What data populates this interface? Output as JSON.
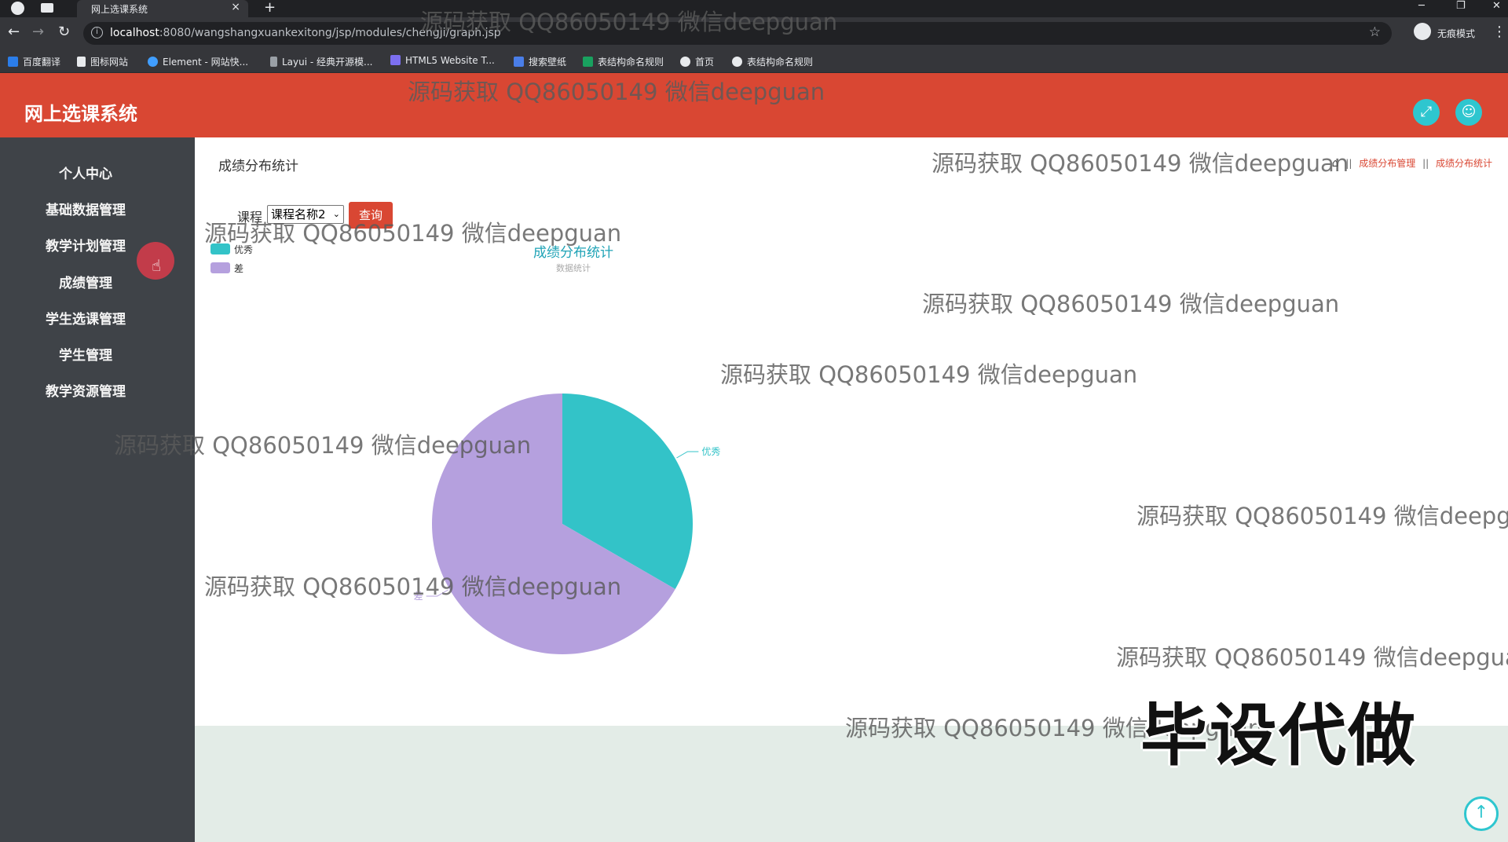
{
  "browser": {
    "tab_title": "网上选课系统",
    "tab_close": "×",
    "new_tab": "+",
    "url_host": "localhost",
    "url_rest": ":8080/wangshangxuankexitong/jsp/modules/chengji/graph.jsp",
    "incognito_label": "无痕模式",
    "bookmarks": [
      "百度翻译",
      "图标网站",
      "Element - 网站快...",
      "Layui - 经典开源模...",
      "HTML5 Website T...",
      "搜索壁纸",
      "表结构命名规则",
      "首页",
      "表结构命名规则"
    ]
  },
  "app": {
    "title": "网上选课系统",
    "expand_icon": "fullscreen-icon",
    "user_icon": "user-icon"
  },
  "sidebar": {
    "items": [
      "个人中心",
      "基础数据管理",
      "教学计划管理",
      "成绩管理",
      "学生选课管理",
      "学生管理",
      "教学资源管理"
    ]
  },
  "main": {
    "page_title": "成绩分布统计",
    "breadcrumb": [
      "成绩分布管理",
      "成绩分布统计"
    ],
    "breadcrumb_sep": "||",
    "filter_label": "课程",
    "filter_value": "课程名称2",
    "query_button": "查询"
  },
  "chart_data": {
    "type": "pie",
    "title": "成绩分布统计",
    "subtitle": "数据统计",
    "legend": [
      "优秀",
      "差"
    ],
    "legend_position": "top-left",
    "series": [
      {
        "name": "优秀",
        "value": 1,
        "color": "#33c3c8"
      },
      {
        "name": "差",
        "value": 2,
        "color": "#b5a0de"
      }
    ]
  },
  "watermark": "源码获取 QQ86050149 微信deepguan",
  "overlay": "毕设代做"
}
